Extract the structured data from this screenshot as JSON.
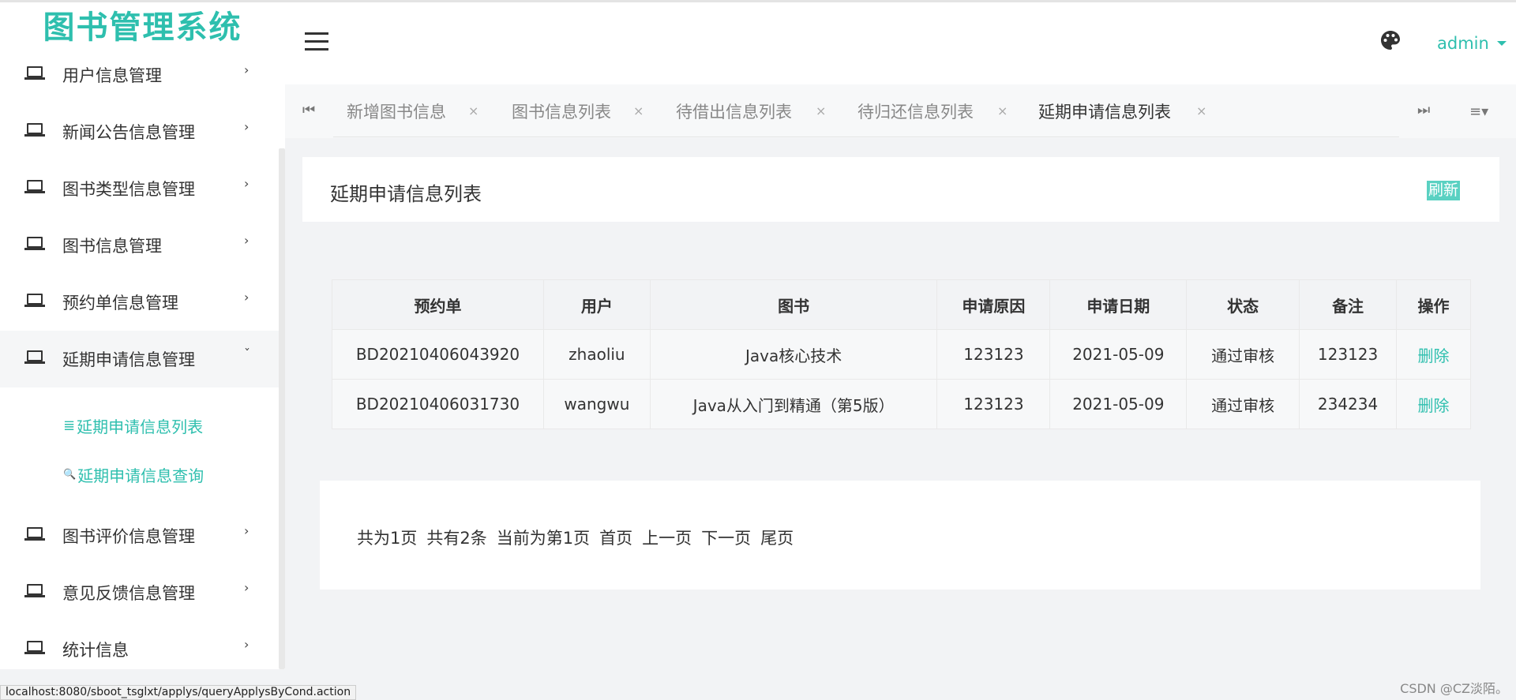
{
  "app": {
    "title": "图书管理系统"
  },
  "sidebar": {
    "items": [
      {
        "label": "用户信息管理",
        "chevron": "›"
      },
      {
        "label": "新闻公告信息管理",
        "chevron": "›"
      },
      {
        "label": "图书类型信息管理",
        "chevron": "›"
      },
      {
        "label": "图书信息管理",
        "chevron": "›"
      },
      {
        "label": "预约单信息管理",
        "chevron": "›"
      },
      {
        "label": "延期申请信息管理",
        "chevron": "ˇ",
        "active": true
      },
      {
        "label": "图书评价信息管理",
        "chevron": "›"
      },
      {
        "label": "意见反馈信息管理",
        "chevron": "›"
      },
      {
        "label": "统计信息",
        "chevron": "›"
      }
    ],
    "submenu": [
      {
        "icon": "≣",
        "label": "延期申请信息列表"
      },
      {
        "icon": "🔍",
        "label": "延期申请信息查询"
      }
    ]
  },
  "header": {
    "user": "admin"
  },
  "tabs": {
    "first": "⏮",
    "last": "⏭",
    "menu": "≡▾",
    "close": "×",
    "items": [
      {
        "label": "新增图书信息"
      },
      {
        "label": "图书信息列表"
      },
      {
        "label": "待借出信息列表"
      },
      {
        "label": "待归还信息列表"
      },
      {
        "label": "延期申请信息列表",
        "active": true
      }
    ]
  },
  "panel": {
    "title": "延期申请信息列表",
    "refresh": "刷新"
  },
  "table": {
    "headers": [
      "预约单",
      "用户",
      "图书",
      "申请原因",
      "申请日期",
      "状态",
      "备注",
      "操作"
    ],
    "rows": [
      {
        "order": "BD20210406043920",
        "user": "zhaoliu",
        "book": "Java核心技术",
        "reason": "123123",
        "date": "2021-05-09",
        "status": "通过审核",
        "note": "123123",
        "action": "删除"
      },
      {
        "order": "BD20210406031730",
        "user": "wangwu",
        "book": "Java从入门到精通（第5版）",
        "reason": "123123",
        "date": "2021-05-09",
        "status": "通过审核",
        "note": "234234",
        "action": "删除"
      }
    ]
  },
  "pager": {
    "total_pages": "共为1页",
    "total_items": "共有2条",
    "current": "当前为第1页",
    "first": "首页",
    "prev": "上一页",
    "next": "下一页",
    "last": "尾页"
  },
  "statusbar": {
    "url": "localhost:8080/sboot_tsglxt/applys/queryApplysByCond.action"
  },
  "watermark": "CSDN @CZ淡陌。",
  "colors": {
    "accent": "#2ebfae",
    "refresh_bg": "#5ad1c2"
  }
}
